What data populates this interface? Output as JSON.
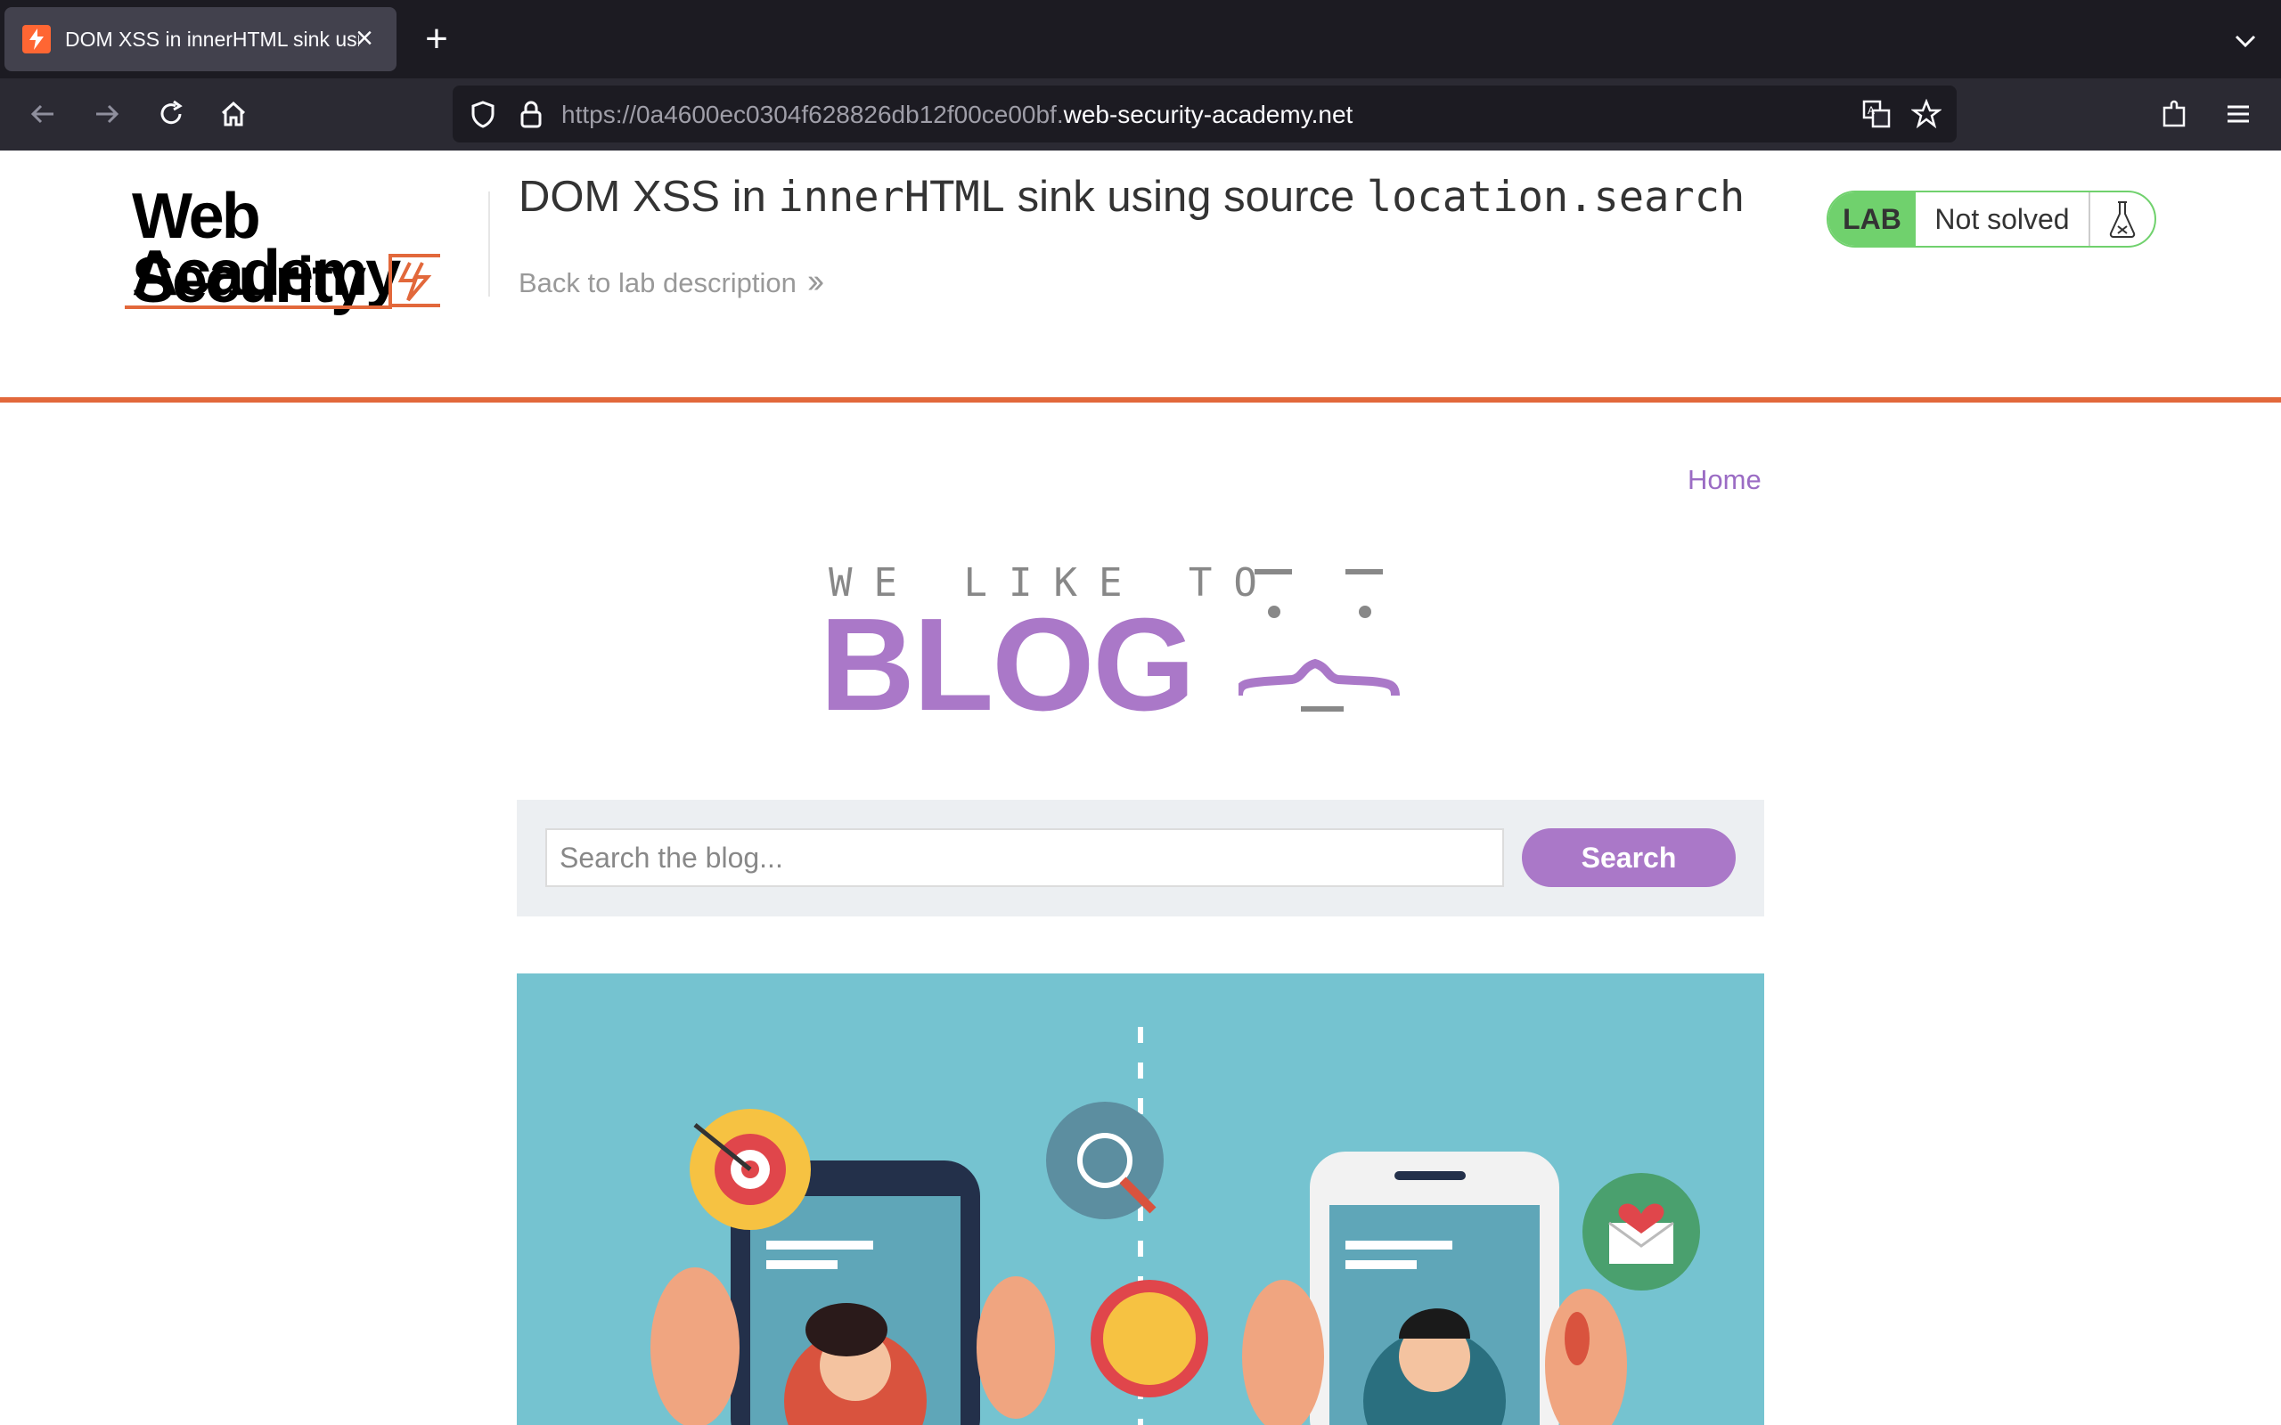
{
  "browser": {
    "tab_title": "DOM XSS in innerHTML sink usi",
    "new_tab_label": "+",
    "url_prefix": "https://0a4600ec0304f628826db12f00ce00bf.",
    "url_domain": "web-security-academy.net"
  },
  "header": {
    "logo_line1": "Web Security",
    "logo_line2": "Academy",
    "lab_title_1": "DOM XSS in ",
    "lab_title_2": "innerHTML",
    "lab_title_3": " sink using source ",
    "lab_title_4": "location.search",
    "back_link": "Back to lab description",
    "lab_badge": "LAB",
    "lab_status": "Not solved"
  },
  "nav": {
    "home": "Home"
  },
  "blog_logo": {
    "tagline": "WE LIKE TO",
    "word": "BLOG"
  },
  "search": {
    "placeholder": "Search the blog...",
    "button": "Search"
  },
  "colors": {
    "accent_orange": "#e2683b",
    "purple": "#aa78c8",
    "lab_green": "#70d16d"
  }
}
